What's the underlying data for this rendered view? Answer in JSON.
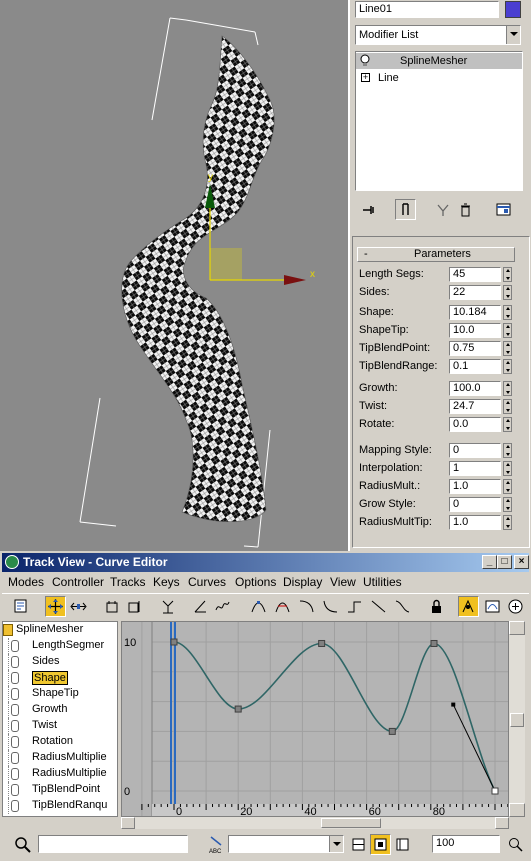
{
  "object_name": "Line01",
  "object_color": "#4a3ed0",
  "modifier_list": "Modifier List",
  "stack": [
    {
      "label": "SplineMesher",
      "icon": "lightbulb-icon",
      "selected": true
    },
    {
      "label": "Line",
      "icon": "expand-icon",
      "selected": false
    }
  ],
  "rollout_title": "Parameters",
  "rollout_toggle": "-",
  "params": [
    {
      "label": "Length Segs:",
      "value": "45"
    },
    {
      "label": "Sides:",
      "value": "22"
    },
    {
      "label": "Shape:",
      "value": "10.184"
    },
    {
      "label": "ShapeTip:",
      "value": "10.0"
    },
    {
      "label": "TipBlendPoint:",
      "value": "0.75"
    },
    {
      "label": "TipBlendRange:",
      "value": "0.1"
    },
    {
      "label": "Growth:",
      "value": "100.0"
    },
    {
      "label": "Twist:",
      "value": "24.7"
    },
    {
      "label": "Rotate:",
      "value": "0.0"
    },
    {
      "label": "Mapping Style:",
      "value": "0"
    },
    {
      "label": "Interpolation:",
      "value": "1"
    },
    {
      "label": "RadiusMult.:",
      "value": "1.0"
    },
    {
      "label": "Grow Style:",
      "value": "0"
    },
    {
      "label": "RadiusMultTip:",
      "value": "1.0"
    }
  ],
  "viewport": {
    "axis_x": "x",
    "axis_y": "y"
  },
  "trackview": {
    "title": "Track View - Curve Editor",
    "window_buttons": [
      "_",
      "□",
      "×"
    ],
    "menu": [
      {
        "label": "Modes",
        "u": "M"
      },
      {
        "label": "Controller",
        "u": "C"
      },
      {
        "label": "Tracks",
        "u": "T"
      },
      {
        "label": "Keys",
        "u": "K"
      },
      {
        "label": "Curves",
        "u": "C"
      },
      {
        "label": "Options",
        "u": "O"
      },
      {
        "label": "Display",
        "u": "D"
      },
      {
        "label": "View",
        "u": "V"
      },
      {
        "label": "Utilities",
        "u": "U"
      }
    ],
    "tree_root": "SplineMesher",
    "tree_items": [
      {
        "label": "LengthSegmer",
        "selected": false
      },
      {
        "label": "Sides",
        "selected": false
      },
      {
        "label": "Shape",
        "selected": true
      },
      {
        "label": "ShapeTip",
        "selected": false
      },
      {
        "label": "Growth",
        "selected": false
      },
      {
        "label": "Twist",
        "selected": false
      },
      {
        "label": "Rotation",
        "selected": false
      },
      {
        "label": "RadiusMultiplie",
        "selected": false
      },
      {
        "label": "RadiusMultiplie",
        "selected": false
      },
      {
        "label": "TipBlendPoint",
        "selected": false
      },
      {
        "label": "TipBlendRanqu",
        "selected": false
      }
    ],
    "graph": {
      "y_labels": [
        "10",
        "0"
      ],
      "x_labels": [
        "0",
        "20",
        "40",
        "60",
        "80"
      ],
      "keys_frame": [
        0,
        20,
        46,
        68,
        81,
        100
      ],
      "keys_value": [
        10,
        5.5,
        9.9,
        4.0,
        9.9,
        0
      ]
    },
    "status_zoom": "100",
    "curve_color": "#2f6666",
    "time_bar_color": "#2a6ac0"
  }
}
